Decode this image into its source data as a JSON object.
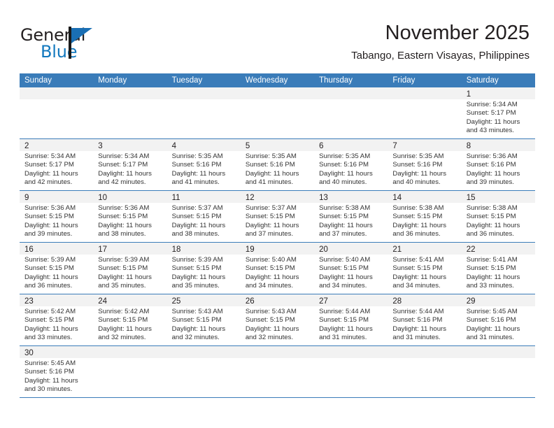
{
  "brand": {
    "name_dark": "General",
    "name_light": "Blue",
    "flag_icon": "blue-flag-icon",
    "accent_color": "#1a6fb4"
  },
  "header": {
    "month_title": "November 2025",
    "location": "Tabango, Eastern Visayas, Philippines"
  },
  "theme": {
    "header_blue": "#3a7cb9",
    "day_band_gray": "#f2f2f2",
    "text_color": "#231f20"
  },
  "calendar": {
    "weekday_headers": [
      "Sunday",
      "Monday",
      "Tuesday",
      "Wednesday",
      "Thursday",
      "Friday",
      "Saturday"
    ],
    "weeks": [
      [
        {
          "empty": true
        },
        {
          "empty": true
        },
        {
          "empty": true
        },
        {
          "empty": true
        },
        {
          "empty": true
        },
        {
          "empty": true
        },
        {
          "day": "1",
          "sunrise": "Sunrise: 5:34 AM",
          "sunset": "Sunset: 5:17 PM",
          "daylight1": "Daylight: 11 hours",
          "daylight2": "and 43 minutes."
        }
      ],
      [
        {
          "day": "2",
          "sunrise": "Sunrise: 5:34 AM",
          "sunset": "Sunset: 5:17 PM",
          "daylight1": "Daylight: 11 hours",
          "daylight2": "and 42 minutes."
        },
        {
          "day": "3",
          "sunrise": "Sunrise: 5:34 AM",
          "sunset": "Sunset: 5:17 PM",
          "daylight1": "Daylight: 11 hours",
          "daylight2": "and 42 minutes."
        },
        {
          "day": "4",
          "sunrise": "Sunrise: 5:35 AM",
          "sunset": "Sunset: 5:16 PM",
          "daylight1": "Daylight: 11 hours",
          "daylight2": "and 41 minutes."
        },
        {
          "day": "5",
          "sunrise": "Sunrise: 5:35 AM",
          "sunset": "Sunset: 5:16 PM",
          "daylight1": "Daylight: 11 hours",
          "daylight2": "and 41 minutes."
        },
        {
          "day": "6",
          "sunrise": "Sunrise: 5:35 AM",
          "sunset": "Sunset: 5:16 PM",
          "daylight1": "Daylight: 11 hours",
          "daylight2": "and 40 minutes."
        },
        {
          "day": "7",
          "sunrise": "Sunrise: 5:35 AM",
          "sunset": "Sunset: 5:16 PM",
          "daylight1": "Daylight: 11 hours",
          "daylight2": "and 40 minutes."
        },
        {
          "day": "8",
          "sunrise": "Sunrise: 5:36 AM",
          "sunset": "Sunset: 5:16 PM",
          "daylight1": "Daylight: 11 hours",
          "daylight2": "and 39 minutes."
        }
      ],
      [
        {
          "day": "9",
          "sunrise": "Sunrise: 5:36 AM",
          "sunset": "Sunset: 5:15 PM",
          "daylight1": "Daylight: 11 hours",
          "daylight2": "and 39 minutes."
        },
        {
          "day": "10",
          "sunrise": "Sunrise: 5:36 AM",
          "sunset": "Sunset: 5:15 PM",
          "daylight1": "Daylight: 11 hours",
          "daylight2": "and 38 minutes."
        },
        {
          "day": "11",
          "sunrise": "Sunrise: 5:37 AM",
          "sunset": "Sunset: 5:15 PM",
          "daylight1": "Daylight: 11 hours",
          "daylight2": "and 38 minutes."
        },
        {
          "day": "12",
          "sunrise": "Sunrise: 5:37 AM",
          "sunset": "Sunset: 5:15 PM",
          "daylight1": "Daylight: 11 hours",
          "daylight2": "and 37 minutes."
        },
        {
          "day": "13",
          "sunrise": "Sunrise: 5:38 AM",
          "sunset": "Sunset: 5:15 PM",
          "daylight1": "Daylight: 11 hours",
          "daylight2": "and 37 minutes."
        },
        {
          "day": "14",
          "sunrise": "Sunrise: 5:38 AM",
          "sunset": "Sunset: 5:15 PM",
          "daylight1": "Daylight: 11 hours",
          "daylight2": "and 36 minutes."
        },
        {
          "day": "15",
          "sunrise": "Sunrise: 5:38 AM",
          "sunset": "Sunset: 5:15 PM",
          "daylight1": "Daylight: 11 hours",
          "daylight2": "and 36 minutes."
        }
      ],
      [
        {
          "day": "16",
          "sunrise": "Sunrise: 5:39 AM",
          "sunset": "Sunset: 5:15 PM",
          "daylight1": "Daylight: 11 hours",
          "daylight2": "and 36 minutes."
        },
        {
          "day": "17",
          "sunrise": "Sunrise: 5:39 AM",
          "sunset": "Sunset: 5:15 PM",
          "daylight1": "Daylight: 11 hours",
          "daylight2": "and 35 minutes."
        },
        {
          "day": "18",
          "sunrise": "Sunrise: 5:39 AM",
          "sunset": "Sunset: 5:15 PM",
          "daylight1": "Daylight: 11 hours",
          "daylight2": "and 35 minutes."
        },
        {
          "day": "19",
          "sunrise": "Sunrise: 5:40 AM",
          "sunset": "Sunset: 5:15 PM",
          "daylight1": "Daylight: 11 hours",
          "daylight2": "and 34 minutes."
        },
        {
          "day": "20",
          "sunrise": "Sunrise: 5:40 AM",
          "sunset": "Sunset: 5:15 PM",
          "daylight1": "Daylight: 11 hours",
          "daylight2": "and 34 minutes."
        },
        {
          "day": "21",
          "sunrise": "Sunrise: 5:41 AM",
          "sunset": "Sunset: 5:15 PM",
          "daylight1": "Daylight: 11 hours",
          "daylight2": "and 34 minutes."
        },
        {
          "day": "22",
          "sunrise": "Sunrise: 5:41 AM",
          "sunset": "Sunset: 5:15 PM",
          "daylight1": "Daylight: 11 hours",
          "daylight2": "and 33 minutes."
        }
      ],
      [
        {
          "day": "23",
          "sunrise": "Sunrise: 5:42 AM",
          "sunset": "Sunset: 5:15 PM",
          "daylight1": "Daylight: 11 hours",
          "daylight2": "and 33 minutes."
        },
        {
          "day": "24",
          "sunrise": "Sunrise: 5:42 AM",
          "sunset": "Sunset: 5:15 PM",
          "daylight1": "Daylight: 11 hours",
          "daylight2": "and 32 minutes."
        },
        {
          "day": "25",
          "sunrise": "Sunrise: 5:43 AM",
          "sunset": "Sunset: 5:15 PM",
          "daylight1": "Daylight: 11 hours",
          "daylight2": "and 32 minutes."
        },
        {
          "day": "26",
          "sunrise": "Sunrise: 5:43 AM",
          "sunset": "Sunset: 5:15 PM",
          "daylight1": "Daylight: 11 hours",
          "daylight2": "and 32 minutes."
        },
        {
          "day": "27",
          "sunrise": "Sunrise: 5:44 AM",
          "sunset": "Sunset: 5:15 PM",
          "daylight1": "Daylight: 11 hours",
          "daylight2": "and 31 minutes."
        },
        {
          "day": "28",
          "sunrise": "Sunrise: 5:44 AM",
          "sunset": "Sunset: 5:16 PM",
          "daylight1": "Daylight: 11 hours",
          "daylight2": "and 31 minutes."
        },
        {
          "day": "29",
          "sunrise": "Sunrise: 5:45 AM",
          "sunset": "Sunset: 5:16 PM",
          "daylight1": "Daylight: 11 hours",
          "daylight2": "and 31 minutes."
        }
      ],
      [
        {
          "day": "30",
          "sunrise": "Sunrise: 5:45 AM",
          "sunset": "Sunset: 5:16 PM",
          "daylight1": "Daylight: 11 hours",
          "daylight2": "and 30 minutes."
        },
        {
          "empty": true
        },
        {
          "empty": true
        },
        {
          "empty": true
        },
        {
          "empty": true
        },
        {
          "empty": true
        },
        {
          "empty": true
        }
      ]
    ]
  }
}
